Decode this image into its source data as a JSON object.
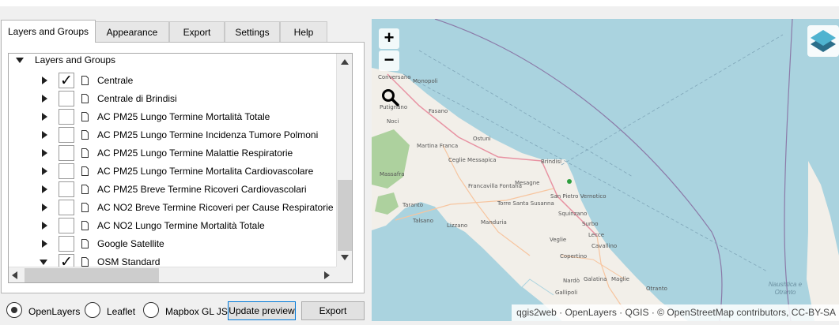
{
  "tabs": [
    {
      "label": "Layers and Groups",
      "active": true
    },
    {
      "label": "Appearance",
      "active": false
    },
    {
      "label": "Export",
      "active": false
    },
    {
      "label": "Settings",
      "active": false
    },
    {
      "label": "Help",
      "active": false
    }
  ],
  "tree": {
    "root_label": "Layers and Groups",
    "root_expanded": true,
    "layers": [
      {
        "label": "Centrale",
        "checked": true,
        "expanded": false
      },
      {
        "label": "Centrale di Brindisi",
        "checked": false,
        "expanded": false
      },
      {
        "label": "AC PM25 Lungo Termine Mortalità Totale",
        "checked": false,
        "expanded": false
      },
      {
        "label": "AC PM25 Lungo Termine Incidenza Tumore Polmoni",
        "checked": false,
        "expanded": false
      },
      {
        "label": "AC PM25 Lungo Termine Malattie Respiratorie",
        "checked": false,
        "expanded": false
      },
      {
        "label": "AC PM25 Lungo Termine Mortalita Cardiovascolare",
        "checked": false,
        "expanded": false
      },
      {
        "label": "AC PM25 Breve Termine Ricoveri Cardiovascolari",
        "checked": false,
        "expanded": false
      },
      {
        "label": "AC NO2 Breve Termine Ricoveri per Cause Respiratorie",
        "checked": false,
        "expanded": false
      },
      {
        "label": "AC NO2 Lungo Termine Mortalità Totale",
        "checked": false,
        "expanded": false
      },
      {
        "label": "Google Satellite",
        "checked": false,
        "expanded": false
      },
      {
        "label": "OSM Standard",
        "checked": true,
        "expanded": true
      }
    ],
    "check_glyph": "✓"
  },
  "format": {
    "options": [
      "OpenLayers",
      "Leaflet",
      "Mapbox GL JS"
    ],
    "selected": "OpenLayers"
  },
  "buttons": {
    "update_preview": "Update preview",
    "export": "Export"
  },
  "map": {
    "zoom_in": "+",
    "zoom_out": "−",
    "search_icon": "magnifier-icon",
    "layers_icon": "layer-stack-icon",
    "attribution": "qgis2web · OpenLayers · QGIS · © OpenStreetMap contributors, CC-BY-SA",
    "towns": [
      "Conversano",
      "Monopoli",
      "Putignano",
      "Fasano",
      "Noci",
      "Ostuni",
      "Martina Franca",
      "Ceglie Messapica",
      "Brindisi",
      "Massafra",
      "Francavilla Fontana",
      "Mesagne",
      "San Pietro Vernotico",
      "Taranto",
      "Torre Santa Susanna",
      "Squinzano",
      "Talsano",
      "Lizzano",
      "Manduria",
      "Surbo",
      "Lecce",
      "Cavallino",
      "Veglie",
      "Copertino",
      "Nardò",
      "Galatina",
      "Maglie",
      "Otranto",
      "Gallipoli"
    ],
    "sea_label": "Naushtica e Otranto",
    "colors": {
      "sea": "#aad3df",
      "land": "#f2efe9",
      "forest": "#add19e",
      "boundary": "#8b7aa8",
      "major_road": "#e892a2",
      "road": "#f7c59f"
    }
  }
}
